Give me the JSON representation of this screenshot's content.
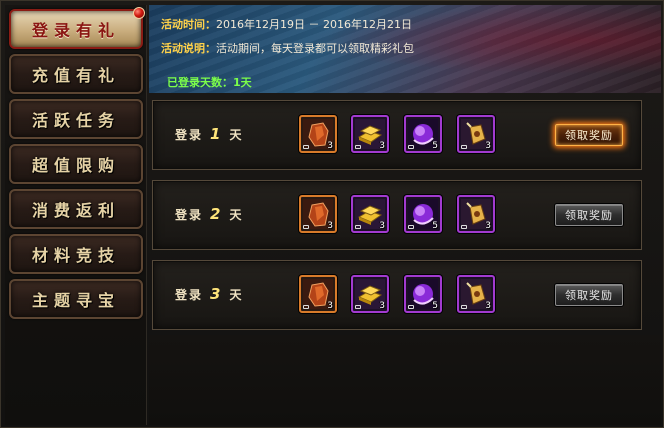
{
  "sidebar": {
    "items": [
      {
        "label": "登录有礼"
      },
      {
        "label": "充值有礼"
      },
      {
        "label": "活跃任务"
      },
      {
        "label": "超值限购"
      },
      {
        "label": "消费返利"
      },
      {
        "label": "材料竞技"
      },
      {
        "label": "主题寻宝"
      }
    ]
  },
  "banner": {
    "time_label": "活动时间：",
    "time_value": "2016年12月19日 － 2016年12月21日",
    "desc_label": "活动说明：",
    "desc_value": "活动期间，每天登录都可以领取精彩礼包",
    "days_label": "已登录天数：",
    "days_value": "1天"
  },
  "rows": [
    {
      "prefix": "登录",
      "day": "1",
      "suffix": "天",
      "button": "领取奖励",
      "items": [
        {
          "icon": "armor-icon",
          "count": "3"
        },
        {
          "icon": "gold-bar-icon",
          "count": "3"
        },
        {
          "icon": "purple-orb-icon",
          "count": "5"
        },
        {
          "icon": "bell-icon",
          "count": "3"
        }
      ]
    },
    {
      "prefix": "登录",
      "day": "2",
      "suffix": "天",
      "button": "领取奖励",
      "items": [
        {
          "icon": "armor-icon",
          "count": "3"
        },
        {
          "icon": "gold-bar-icon",
          "count": "3"
        },
        {
          "icon": "purple-orb-icon",
          "count": "5"
        },
        {
          "icon": "bell-icon",
          "count": "3"
        }
      ]
    },
    {
      "prefix": "登录",
      "day": "3",
      "suffix": "天",
      "button": "领取奖励",
      "items": [
        {
          "icon": "armor-icon",
          "count": "3"
        },
        {
          "icon": "gold-bar-icon",
          "count": "3"
        },
        {
          "icon": "purple-orb-icon",
          "count": "5"
        },
        {
          "icon": "bell-icon",
          "count": "3"
        }
      ]
    }
  ]
}
